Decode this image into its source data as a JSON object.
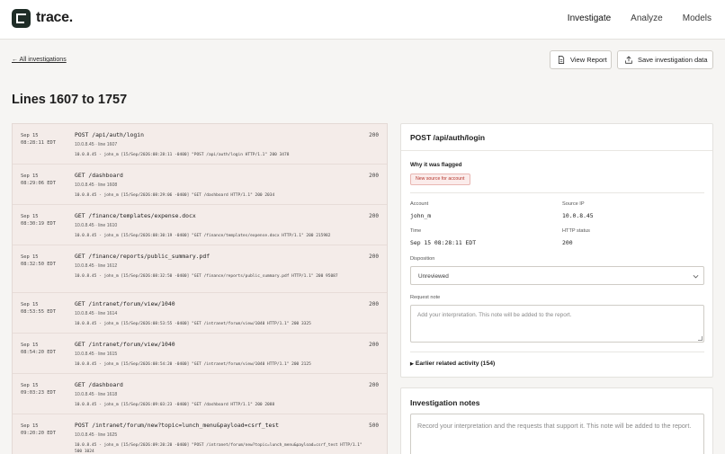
{
  "app": {
    "name": "trace."
  },
  "nav": [
    {
      "label": "Investigate",
      "active": true
    },
    {
      "label": "Analyze",
      "active": false
    },
    {
      "label": "Models",
      "active": false
    }
  ],
  "back_link": "← All investigations",
  "buttons": {
    "view_report": "View Report",
    "save_data": "Save investigation data"
  },
  "page_title": "Lines 1607 to 1757",
  "log_rows": [
    {
      "date": "Sep 15",
      "time": "08:28:11 EDT",
      "request": "POST /api/auth/login",
      "meta": "10.0.8.45 · line 1607",
      "raw": "10.0.8.45 - john_m [15/Sep/2026:08:28:11 -0400] \"POST /api/auth/login HTTP/1.1\" 200 3478",
      "status": "200"
    },
    {
      "date": "Sep 15",
      "time": "08:29:06 EDT",
      "request": "GET /dashboard",
      "meta": "10.0.8.45 · line 1608",
      "raw": "10.0.8.45 - john_m [15/Sep/2026:08:29:06 -0400] \"GET /dashboard HTTP/1.1\" 200 2034",
      "status": "200"
    },
    {
      "date": "Sep 15",
      "time": "08:30:19 EDT",
      "request": "GET /finance/templates/expense.docx",
      "meta": "10.0.8.45 · line 1610",
      "raw": "10.0.8.45 - john_m [15/Sep/2026:08:30:19 -0400] \"GET /finance/templates/expense.docx HTTP/1.1\" 200 215982",
      "status": "200"
    },
    {
      "date": "Sep 15",
      "time": "08:32:50 EDT",
      "request": "GET /finance/reports/public_summary.pdf",
      "meta": "10.0.8.45 · line 1612",
      "raw": "10.0.8.45 - john_m [15/Sep/2026:08:32:50 -0400] \"GET /finance/reports/public_summary.pdf HTTP/1.1\" 200 95087",
      "status": "200"
    },
    {
      "date": "Sep 15",
      "time": "08:53:55 EDT",
      "request": "GET /intranet/forum/view/1040",
      "meta": "10.0.8.45 · line 1614",
      "raw": "10.0.8.45 - john_m [15/Sep/2026:08:53:55 -0400] \"GET /intranet/forum/view/1040 HTTP/1.1\" 200 3325",
      "status": "200"
    },
    {
      "date": "Sep 15",
      "time": "08:54:20 EDT",
      "request": "GET /intranet/forum/view/1040",
      "meta": "10.0.8.45 · line 1615",
      "raw": "10.0.8.45 - john_m [15/Sep/2026:08:54:20 -0400] \"GET /intranet/forum/view/1040 HTTP/1.1\" 200 2125",
      "status": "200"
    },
    {
      "date": "Sep 15",
      "time": "09:03:23 EDT",
      "request": "GET /dashboard",
      "meta": "10.0.8.45 · line 1618",
      "raw": "10.0.8.45 - john_m [15/Sep/2026:09:03:23 -0400] \"GET /dashboard HTTP/1.1\" 200 2088",
      "status": "200"
    },
    {
      "date": "Sep 15",
      "time": "09:20:20 EDT",
      "request": "POST /intranet/forum/new?topic=lunch_menu&payload=csrf_test",
      "meta": "10.0.8.45 · line 1625",
      "raw": "10.0.8.45 - john_m [15/Sep/2026:09:20:20 -0400] \"POST /intranet/forum/new?topic=lunch_menu&payload=csrf_test HTTP/1.1\" 500 1024",
      "status": "500"
    }
  ],
  "detail": {
    "title": "POST /api/auth/login",
    "why_label": "Why it was flagged",
    "flag": "New source for account",
    "account_label": "Account",
    "account": "john_m",
    "source_ip_label": "Source IP",
    "source_ip": "10.0.8.45",
    "time_label": "Time",
    "time": "Sep 15 08:28:11 EDT",
    "http_status_label": "HTTP status",
    "http_status": "200",
    "disposition_label": "Disposition",
    "disposition": "Unreviewed",
    "request_note_label": "Request note",
    "request_note_placeholder": "Add your interpretation. This note will be added to the report.",
    "earlier_activity": "Earlier related activity (154)"
  },
  "notes": {
    "title": "Investigation notes",
    "placeholder": "Record your interpretation and the requests that support it. This note will be added to the report."
  },
  "colors": {
    "flag_text": "#b4362d",
    "flag_bg": "#fbeceb",
    "log_bg": "#f4ece9",
    "logo": "#1f2d27"
  }
}
